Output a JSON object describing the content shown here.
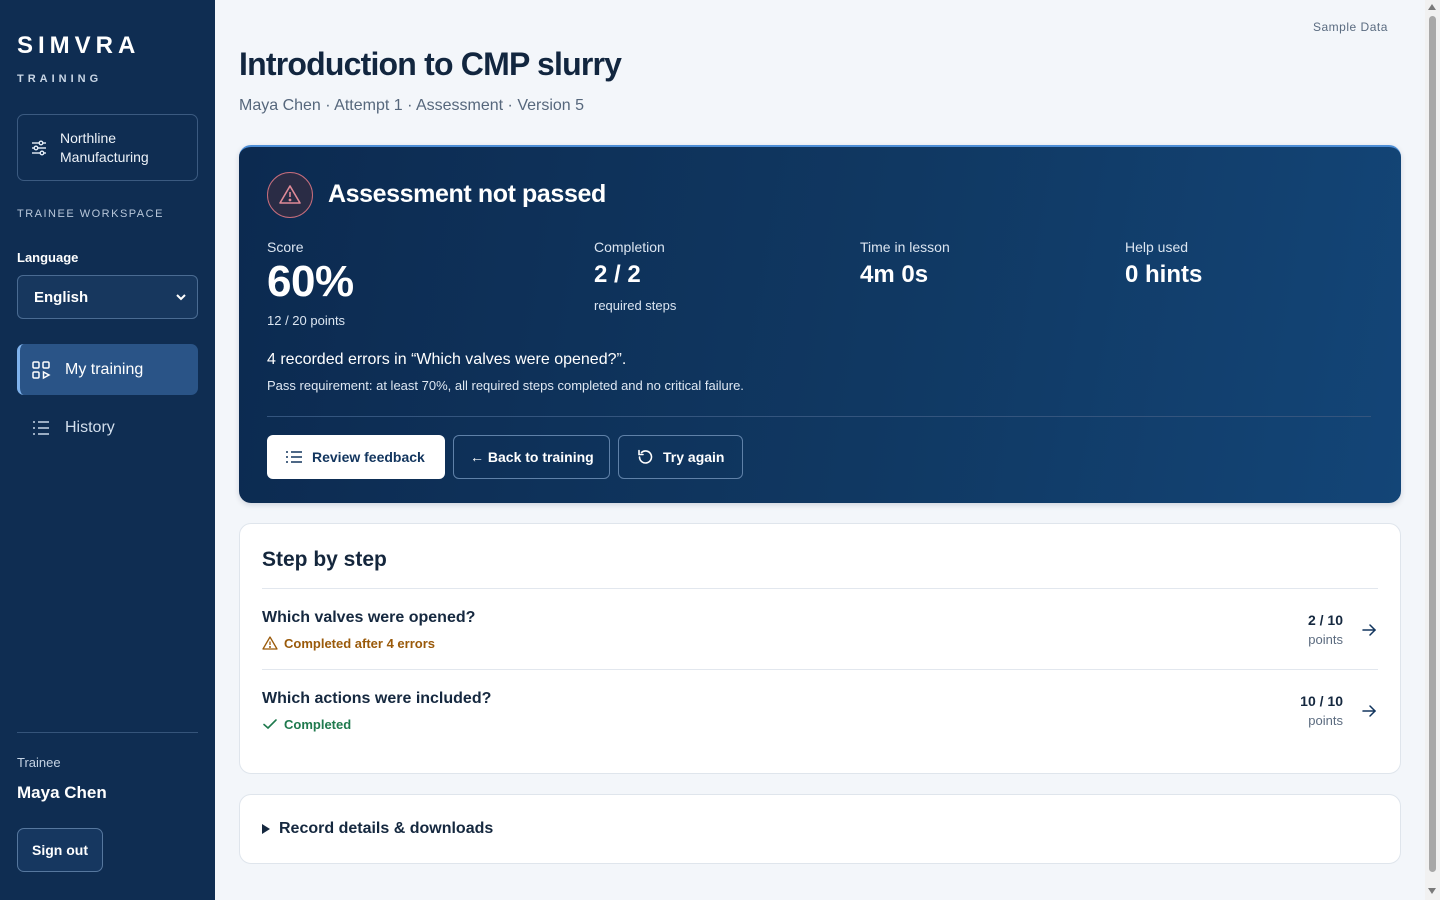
{
  "brand": {
    "name": "SIMVRA",
    "sub": "TRAINING"
  },
  "sidebar": {
    "organization": "Northline Manufacturing",
    "workspace_label": "TRAINEE WORKSPACE",
    "language_label": "Language",
    "language_value": "English",
    "items": [
      {
        "label": "My training",
        "icon": "grid-play-icon",
        "active": true
      },
      {
        "label": "History",
        "icon": "list-icon",
        "active": false
      }
    ],
    "trainee_label": "Trainee",
    "trainee_name": "Maya Chen",
    "sign_out": "Sign out"
  },
  "header": {
    "sample_data": "Sample Data",
    "title": "Introduction to CMP slurry",
    "subtitle": "Maya Chen · Attempt 1 · Assessment · Version 5"
  },
  "result": {
    "title": "Assessment not passed",
    "score_label": "Score",
    "score_value": "60%",
    "score_points": "12 / 20 points",
    "completion_label": "Completion",
    "completion_value": "2 / 2",
    "completion_sub": "required steps",
    "time_label": "Time in lesson",
    "time_value": "4m 0s",
    "help_label": "Help used",
    "help_value": "0 hints",
    "errors_line": "4 recorded errors in “Which valves were opened?”.",
    "pass_requirement": "Pass requirement: at least 70%, all required steps completed and no critical failure.",
    "buttons": {
      "review": "Review feedback",
      "back": "← Back to training",
      "retry": "Try again"
    },
    "colors": {
      "card_bg": "#0c2a50",
      "alert": "#e08a98"
    }
  },
  "steps": {
    "title": "Step by step",
    "rows": [
      {
        "name": "Which valves were opened?",
        "status": "Completed after 4 errors",
        "status_type": "warning",
        "points": "2 / 10",
        "unit": "points"
      },
      {
        "name": "Which actions were included?",
        "status": "Completed",
        "status_type": "success",
        "points": "10 / 10",
        "unit": "points"
      }
    ],
    "colors": {
      "warning": "#9a5a0a",
      "success": "#1f7a4e"
    }
  },
  "details": {
    "label": "Record details & downloads"
  }
}
